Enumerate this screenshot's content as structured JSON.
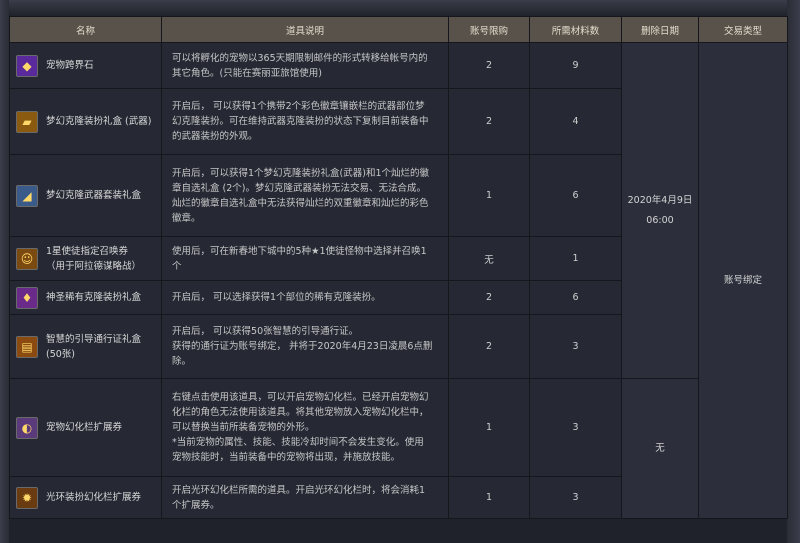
{
  "table": {
    "headers": [
      "名称",
      "道具说明",
      "账号限购",
      "所需材料数",
      "删除日期",
      "交易类型"
    ],
    "rows": [
      {
        "icon": "pet-stone-icon",
        "name": [
          "宠物跨界石"
        ],
        "desc": [
          "可以将孵化的宠物以365天期限制邮件的形式转移给帐号内的",
          "其它角色。(只能在赛丽亚旅馆使用)"
        ],
        "limit": "2",
        "material": "9"
      },
      {
        "icon": "weapon-box-icon",
        "name": [
          "梦幻克隆装扮礼盒 (武器)"
        ],
        "desc": [
          "开启后，  可以获得1个携带2个彩色徽章镶嵌栏的武器部位梦",
          "幻克隆装扮。可在维持武器克隆装扮的状态下复制目前装备中",
          "的武器装扮的外观。"
        ],
        "limit": "2",
        "material": "4"
      },
      {
        "icon": "weapon-set-icon",
        "name": [
          "梦幻克隆武器套装礼盒"
        ],
        "desc": [
          "开启后，可以获得1个梦幻克隆装扮礼盒(武器)和1个灿烂的徽",
          "章自选礼盒 (2个)。梦幻克隆武器装扮无法交易、无法合成。",
          "灿烂的徽章自选礼盒中无法获得灿烂的双重徽章和灿烂的彩色",
          "徽章。"
        ],
        "limit": "1",
        "material": "6"
      },
      {
        "icon": "summon-ticket-icon",
        "name": [
          "1星使徒指定召唤券",
          "（用于阿拉德谋略战）"
        ],
        "desc": [
          "使用后，可在新春地下城中的5种★1使徒怪物中选择并召唤1",
          "个"
        ],
        "limit": "无",
        "material": "1"
      },
      {
        "icon": "rare-clone-box-icon",
        "name": [
          "神圣稀有克隆装扮礼盒"
        ],
        "desc": [
          "开启后，  可以选择获得1个部位的稀有克隆装扮。"
        ],
        "limit": "2",
        "material": "6"
      },
      {
        "icon": "pass-box-icon",
        "name": [
          "智慧的引导通行证礼盒",
          "(50张)"
        ],
        "desc": [
          "开启后，  可以获得50张智慧的引导通行证。",
          "获得的通行证为账号绑定，  并将于2020年4月23日凌晨6点删",
          "除。"
        ],
        "limit": "2",
        "material": "3"
      },
      {
        "icon": "pet-expand-icon",
        "name": [
          "宠物幻化栏扩展券"
        ],
        "desc": [
          "右键点击使用该道具，可以开启宠物幻化栏。已经开启宠物幻",
          "化栏的角色无法使用该道具。将其他宠物放入宠物幻化栏中，",
          "可以替换当前所装备宠物的外形。",
          "*当前宠物的属性、技能、技能冷却时间不会发生变化。使用",
          "宠物技能时，当前装备中的宠物将出现，并施放技能。"
        ],
        "limit": "1",
        "material": "3"
      },
      {
        "icon": "aura-expand-icon",
        "name": [
          "光环装扮幻化栏扩展券"
        ],
        "desc": [
          "开启光环幻化栏所需的道具。开启光环幻化栏时，将会消耗1",
          "个扩展券。"
        ],
        "limit": "1",
        "material": "3"
      }
    ],
    "delete_date_line1": "2020年4月9日",
    "delete_date_line2": "06:00",
    "delete_none": "无",
    "trade_type": "账号绑定"
  },
  "icon_colors": {
    "pet-stone-icon": "#5a2a9c",
    "weapon-box-icon": "#8a5a10",
    "weapon-set-icon": "#3a5a8a",
    "summon-ticket-icon": "#7a4a10",
    "rare-clone-box-icon": "#6a2a8a",
    "pass-box-icon": "#8a4a10",
    "pet-expand-icon": "#5a3a7a",
    "aura-expand-icon": "#6a3a10"
  }
}
